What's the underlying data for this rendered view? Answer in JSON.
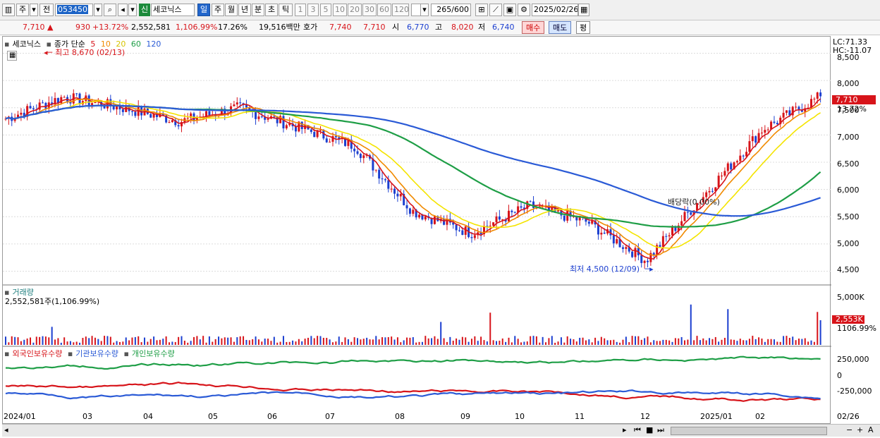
{
  "toolbar": {
    "type_label": "주",
    "prev_label": "전",
    "stock_code": "053450",
    "stock_badge": "신",
    "stock_name": "세코닉스",
    "periods": [
      "일",
      "주",
      "월",
      "년",
      "분",
      "초",
      "틱"
    ],
    "intervals": [
      "1",
      "3",
      "5",
      "10",
      "20",
      "30",
      "60",
      "120"
    ],
    "count": "265",
    "count_total": "/600",
    "date": "2025/02/26"
  },
  "quote": {
    "price": "7,710",
    "change": "930",
    "change_pct": "+13.72%",
    "volume": "2,552,581",
    "volume_pct": "1,106.99%",
    "turnover": "17.26%",
    "amount": "19,516백만",
    "hoga_label": "호가",
    "hoga1": "7,740",
    "hoga2": "7,710",
    "open_label": "시",
    "open": "6,770",
    "high_label": "고",
    "high": "8,020",
    "low_label": "저",
    "low": "6,740",
    "buy": "매수",
    "sell": "매도",
    "eval": "평"
  },
  "price_panel": {
    "name": "세코닉스",
    "legend_prefix": "종가 단순",
    "ma_labels": [
      "5",
      "10",
      "20",
      "60",
      "120"
    ],
    "ma_colors": [
      "#d7141a",
      "#f08a00",
      "#f4e400",
      "#1e9e46",
      "#2a5ad6"
    ],
    "high_note": "최고 8,670 (02/13)",
    "low_note": "최저 4,500 (12/09)",
    "dividend_note": "배당락(0.00%)",
    "lc": "LC:71.33",
    "hc": "HC:-11.07",
    "last_price": "7,710",
    "last_pct": "13.72%",
    "ticks": [
      "8,500",
      "8,000",
      "7,500",
      "7,000",
      "6,500",
      "6,000",
      "5,500",
      "5,000",
      "4,500"
    ]
  },
  "volume_panel": {
    "title": "거래량",
    "value": "2,552,581주(1,106.99%)",
    "tick": "5,000K",
    "last": "2,553K",
    "last_pct": "1106.99%"
  },
  "holding_panel": {
    "series": [
      "외국인보유수량",
      "기관보유수량",
      "개인보유수량"
    ],
    "ticks": [
      "250,000",
      "0",
      "-250,000"
    ]
  },
  "xaxis": {
    "labels": [
      "2024/01",
      "03",
      "04",
      "05",
      "06",
      "07",
      "08",
      "09",
      "10",
      "11",
      "12",
      "2025/01",
      "02",
      "02/26"
    ]
  },
  "chart_data": {
    "type": "candlestick",
    "series": [
      {
        "name": "종가",
        "x": [
          "2024/01",
          "2024/02",
          "2024/03",
          "2024/04",
          "2024/05",
          "2024/06",
          "2024/07",
          "2024/08",
          "2024/09",
          "2024/10",
          "2024/11",
          "2024/12",
          "2025/01",
          "2025/02",
          "02/26"
        ],
        "values": [
          7300,
          7700,
          7500,
          7250,
          7500,
          7150,
          6800,
          5600,
          5200,
          5700,
          5400,
          4700,
          5900,
          7100,
          7710
        ]
      }
    ],
    "ylim": [
      4300,
      8700
    ],
    "grid": true
  }
}
